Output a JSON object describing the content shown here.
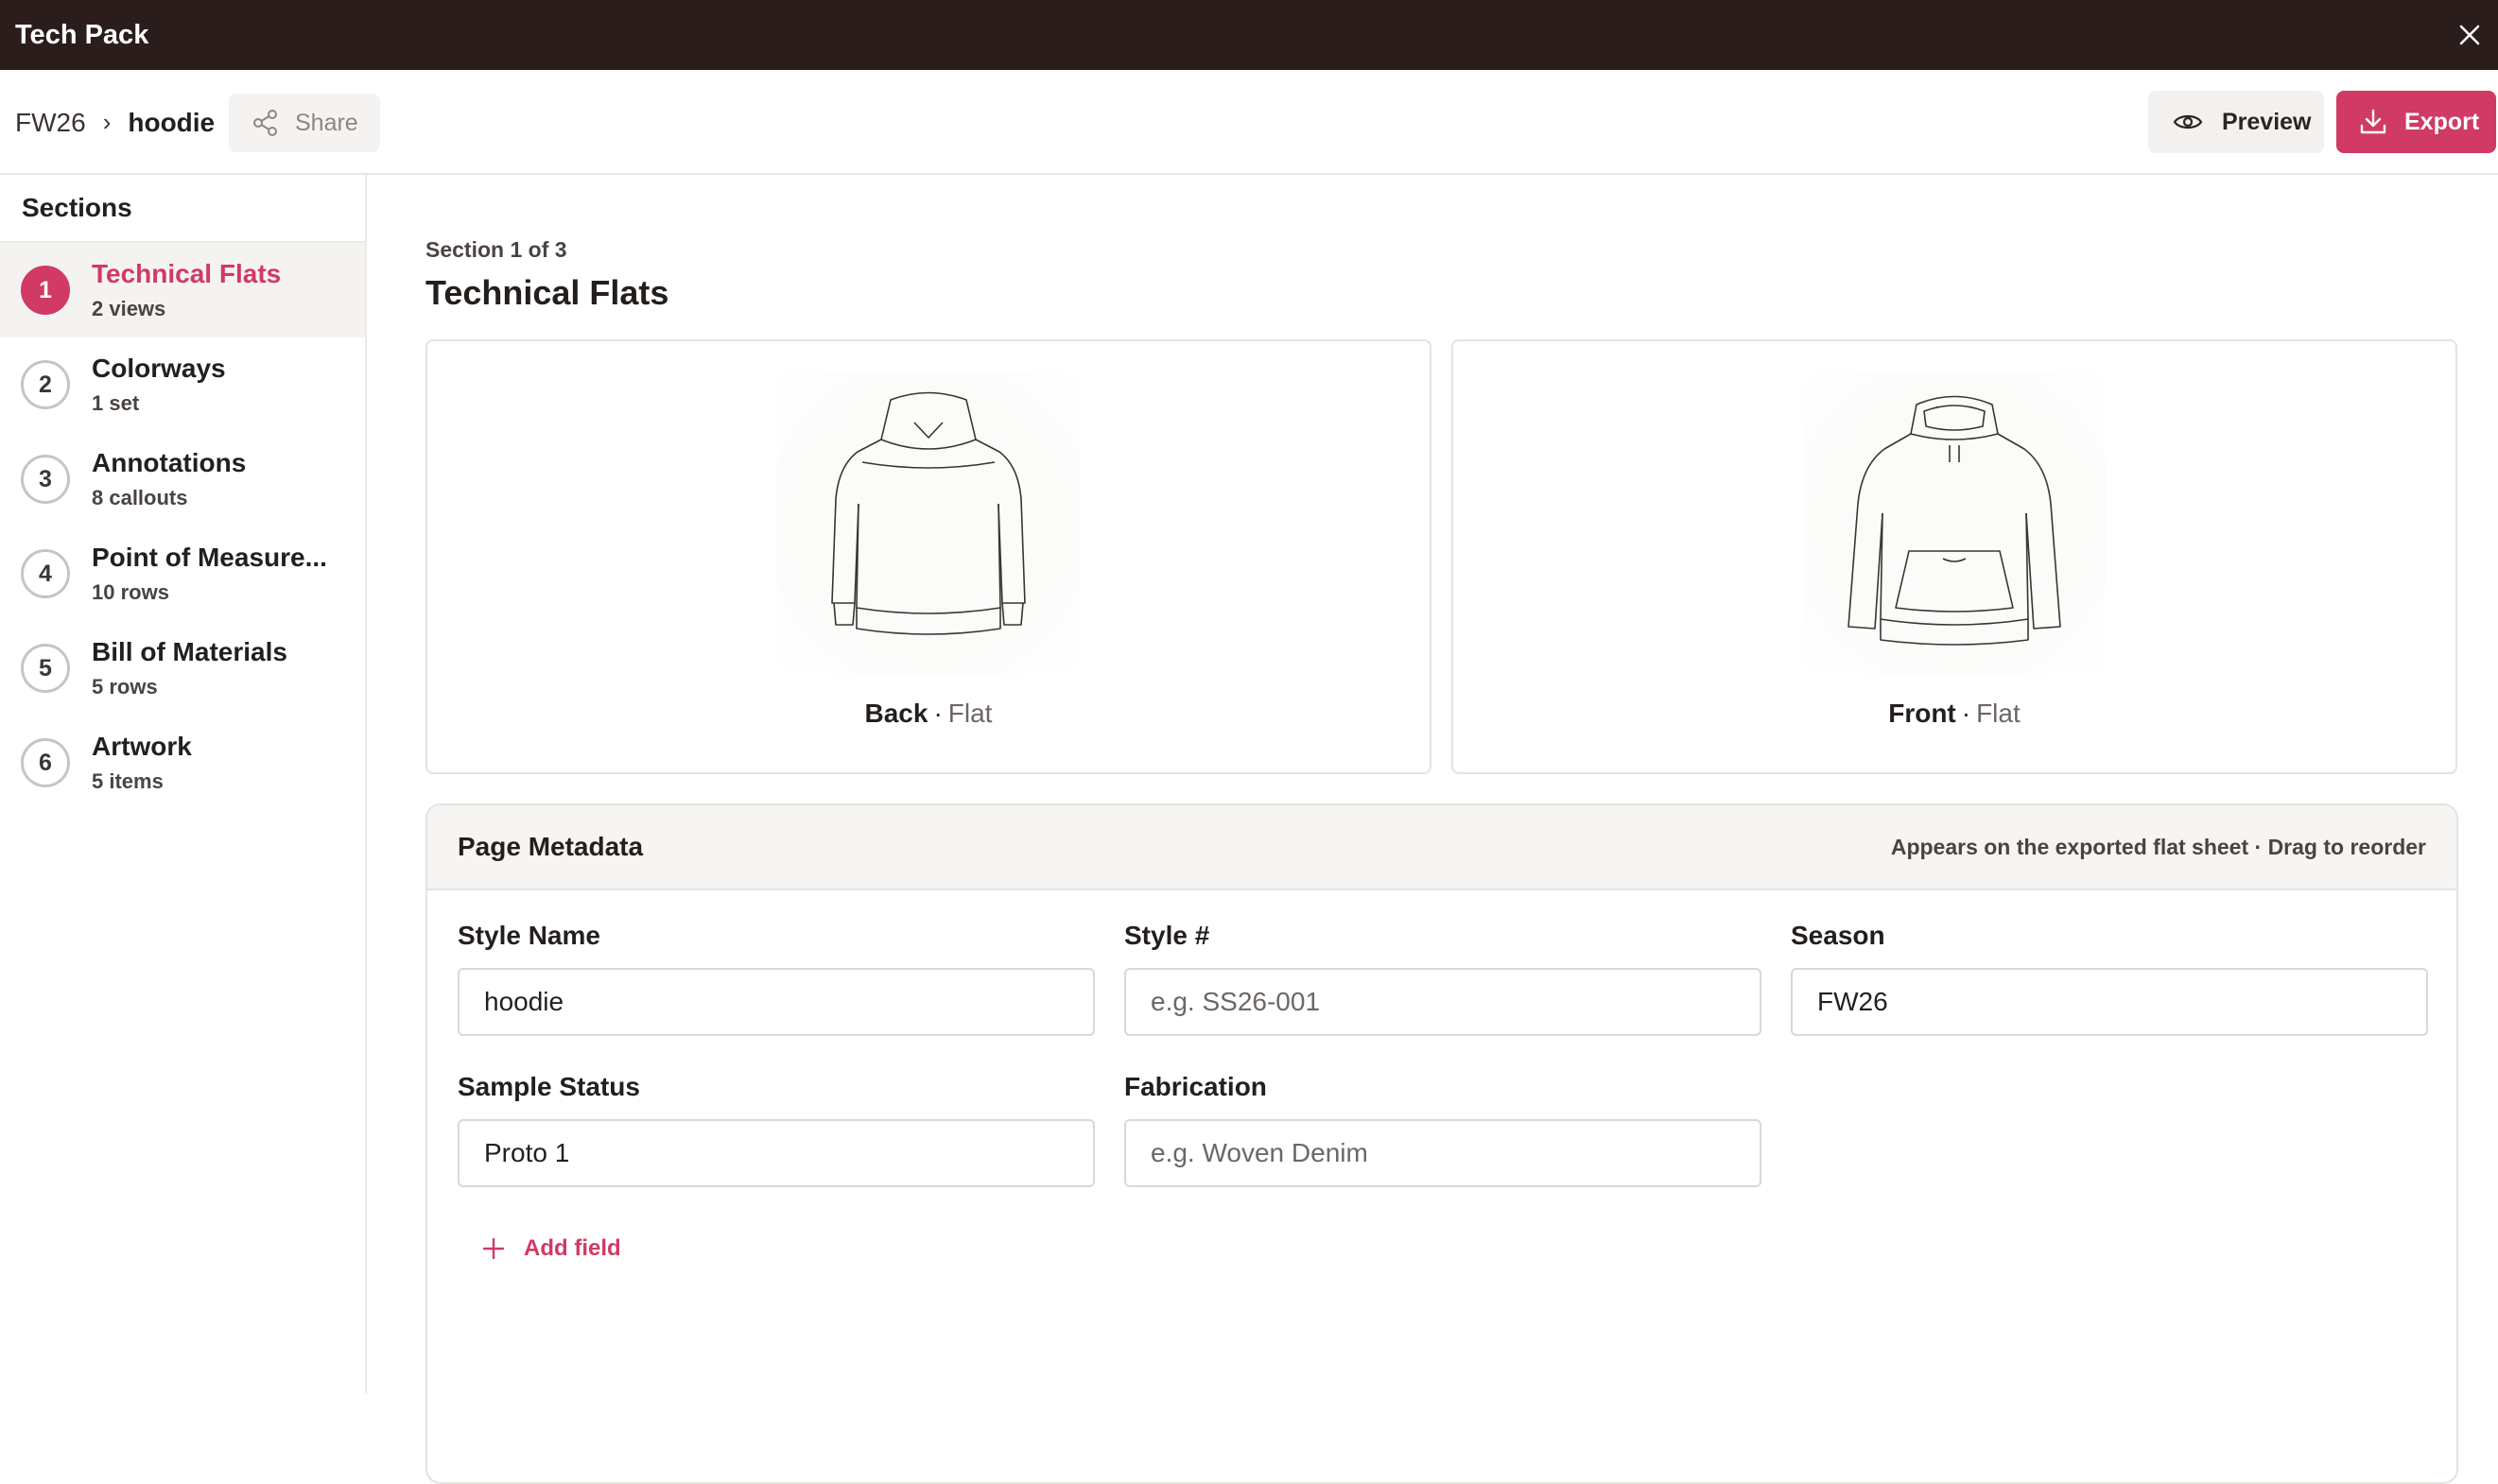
{
  "app": {
    "title": "Tech Pack"
  },
  "breadcrumb": {
    "season": "FW26",
    "separator": "›",
    "style": "hoodie"
  },
  "toolbar": {
    "share_label": "Share",
    "preview_label": "Preview",
    "export_label": "Export"
  },
  "colors": {
    "accent": "#d03a64",
    "titlebar": "#2a1d1c"
  },
  "sidebar": {
    "heading": "Sections",
    "items": [
      {
        "num": "1",
        "label": "Technical Flats",
        "sub": "2 views",
        "active": true
      },
      {
        "num": "2",
        "label": "Colorways",
        "sub": "1 set"
      },
      {
        "num": "3",
        "label": "Annotations",
        "sub": "8 callouts"
      },
      {
        "num": "4",
        "label": "Point of Measure...",
        "sub": "10 rows"
      },
      {
        "num": "5",
        "label": "Bill of Materials",
        "sub": "5 rows"
      },
      {
        "num": "6",
        "label": "Artwork",
        "sub": "5 items"
      }
    ]
  },
  "main": {
    "section_meta": "Section 1 of 3",
    "section_title": "Technical Flats",
    "flats": [
      {
        "view": "Back",
        "type": "Flat"
      },
      {
        "view": "Front",
        "type": "Flat"
      }
    ]
  },
  "metadata": {
    "title": "Page Metadata",
    "hint": "Appears on the exported flat sheet · Drag to reorder",
    "fields": [
      {
        "label": "Style Name",
        "value": "hoodie",
        "placeholder": ""
      },
      {
        "label": "Style #",
        "value": "",
        "placeholder": "e.g. SS26-001"
      },
      {
        "label": "Season",
        "value": "FW26",
        "placeholder": ""
      },
      {
        "label": "Sample Status",
        "value": "Proto 1",
        "placeholder": ""
      },
      {
        "label": "Fabrication",
        "value": "",
        "placeholder": "e.g. Woven Denim"
      }
    ],
    "add_field_label": "Add field"
  }
}
